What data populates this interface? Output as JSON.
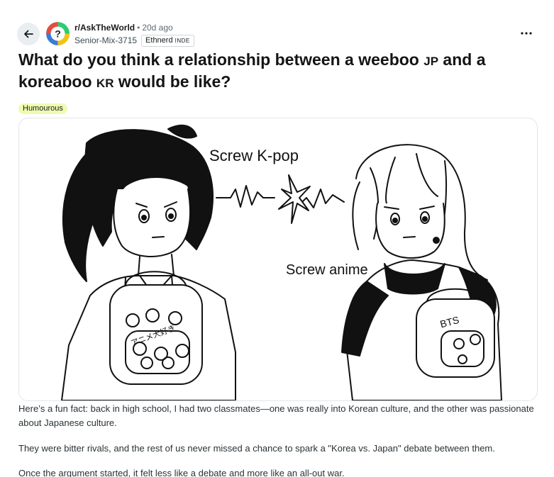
{
  "header": {
    "subreddit": "r/AskTheWorld",
    "separator": "•",
    "time_ago": "20d ago",
    "author": "Senior-Mix-3715",
    "user_flair_main": "Ethnerd",
    "user_flair_small": "INDE",
    "icons": {
      "back": "arrow-left-icon",
      "more": "ellipsis-icon",
      "avatar": "question-globe-icon"
    }
  },
  "post": {
    "title_part1": "What do you think a relationship between a weeboo ",
    "title_code1": "JP",
    "title_part2": " and a koreaboo ",
    "title_code2": "KR",
    "title_part3": " would be like?",
    "flair": "Humourous",
    "flair_color": "#eefcb1"
  },
  "image": {
    "speech_left": "Screw K-pop",
    "speech_right": "Screw anime",
    "bag_right_text": "BTS",
    "bag_left_text": "アニメ大好き"
  },
  "body": {
    "p1": "Here’s a fun fact: back in high school, I had two classmates—one was really into Korean culture, and the other was passionate about Japanese culture.",
    "p2": "They were bitter rivals, and the rest of us never missed a chance to spark a \"Korea vs. Japan\" debate between them.",
    "p3": "Once the argument started, it felt less like a debate and more like an all-out war."
  }
}
